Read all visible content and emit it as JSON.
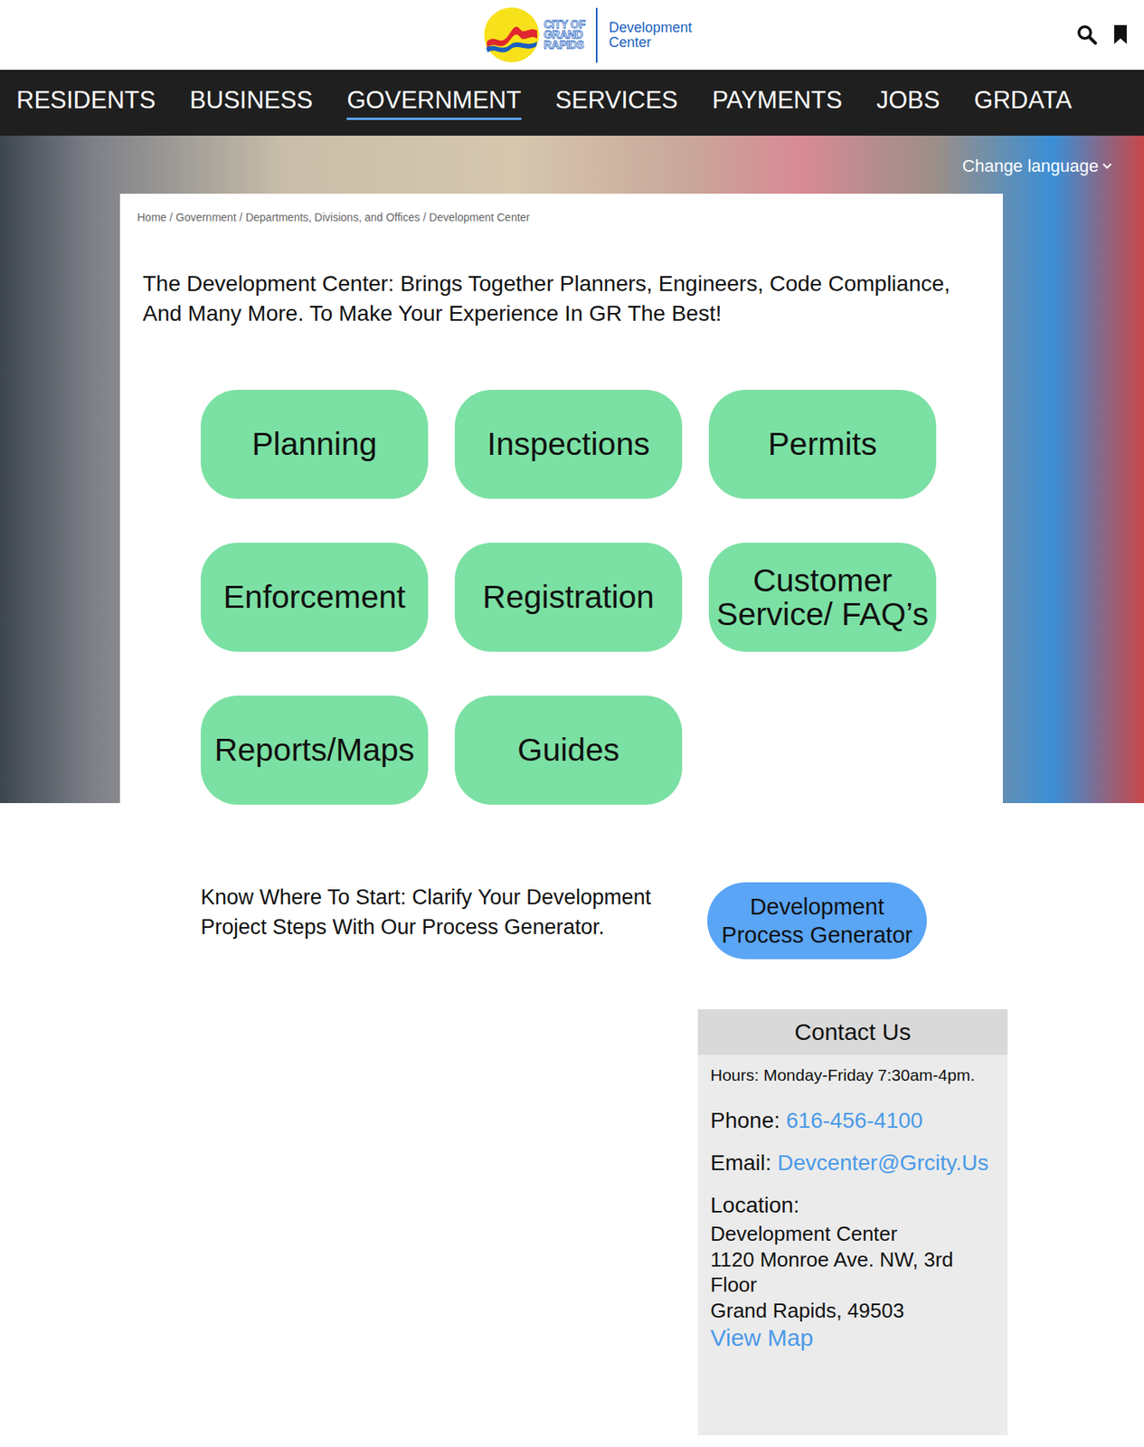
{
  "header": {
    "logo": {
      "city_lines": [
        "CITY OF",
        "GRAND",
        "RAPIDS"
      ],
      "site_lines": [
        "Development",
        "Center"
      ]
    }
  },
  "nav": [
    {
      "label": "RESIDENTS",
      "selected": false
    },
    {
      "label": "BUSINESS",
      "selected": false
    },
    {
      "label": "GOVERNMENT",
      "selected": true
    },
    {
      "label": "SERVICES",
      "selected": false
    },
    {
      "label": "PAYMENTS",
      "selected": false
    },
    {
      "label": "JOBS",
      "selected": false
    },
    {
      "label": "GRDATA",
      "selected": false
    }
  ],
  "language": {
    "label": "Change language"
  },
  "breadcrumb": [
    "Home",
    "Government",
    "Departments, Divisions, and Offices",
    "Development Center"
  ],
  "breadcrumb_separator": "/",
  "heading": "The Development Center: Brings Together Planners, Engineers, Code Compliance, And Many More. To Make Your Experience In GR The Best!",
  "tiles": [
    "Planning",
    "Inspections",
    "Permits",
    "Enforcement",
    "Registration",
    "Customer Service/ FAQ’s",
    "Reports/Maps",
    "Guides"
  ],
  "process": {
    "text": "Know Where To Start: Clarify Your Development Project Steps With Our Process Generator.",
    "button": "Development Process Generator"
  },
  "contact": {
    "title": "Contact Us",
    "hours": "Hours: Monday-Friday 7:30am-4pm.",
    "phone_label": "Phone:",
    "phone": "616-456-4100",
    "email_label": "Email:",
    "email": "Devcenter@Grcity.Us",
    "location_label": "Location:",
    "address_lines": [
      "Development Center",
      "1120 Monroe Ave. NW, 3rd Floor",
      "Grand Rapids, 49503"
    ],
    "map_link": "View Map"
  }
}
